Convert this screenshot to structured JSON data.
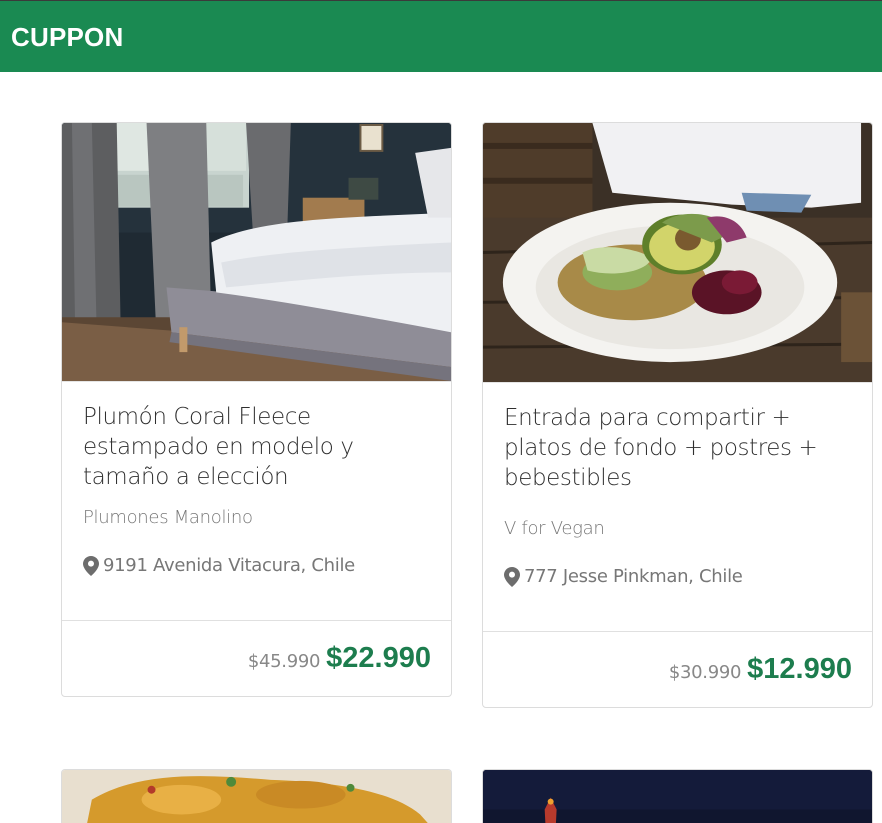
{
  "app": {
    "brand": "CUPPON"
  },
  "deals": [
    {
      "title": "Plumón Coral Fleece estampado en modelo y tamaño a elección",
      "merchant": "Plumones Manolino",
      "address": "9191 Avenida Vitacura, Chile",
      "old_price": "$45.990",
      "new_price": "$22.990",
      "image": "bedroom-photo"
    },
    {
      "title": "Entrada para compartir + platos de fondo + postres + bebestibles",
      "merchant": "V for Vegan",
      "address": "777 Jesse Pinkman, Chile",
      "old_price": "$30.990",
      "new_price": "$12.990",
      "image": "vegan-plate-photo"
    },
    {
      "image": "food-photo"
    },
    {
      "image": "night-photo"
    }
  ],
  "icons": {
    "location": "map-marker-icon"
  },
  "colors": {
    "navbar": "#1a8a52",
    "price": "#1d7d4e"
  }
}
